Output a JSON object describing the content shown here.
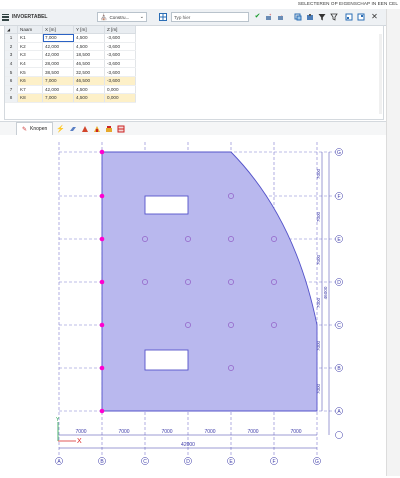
{
  "top_strip": {
    "selection_label": "SELECTEREN OP EIGENSCHAP IN EEN CEL"
  },
  "toolbar": {
    "title": "INVOERTABEL",
    "construction_dropdown": "Constru...",
    "filter_placeholder": "Typ hier"
  },
  "table": {
    "columns": [
      "Naam",
      "X [m]",
      "Y [m]",
      "Z [m]"
    ],
    "rows": [
      {
        "num": "1",
        "name": "K1",
        "x": "7,000",
        "y": "4,500",
        "z": "-3,600",
        "highlight": false
      },
      {
        "num": "2",
        "name": "K2",
        "x": "42,000",
        "y": "4,500",
        "z": "-3,600",
        "highlight": false
      },
      {
        "num": "3",
        "name": "K3",
        "x": "42,000",
        "y": "18,500",
        "z": "-3,600",
        "highlight": false
      },
      {
        "num": "4",
        "name": "K4",
        "x": "28,000",
        "y": "46,500",
        "z": "-3,600",
        "highlight": false
      },
      {
        "num": "5",
        "name": "K5",
        "x": "38,500",
        "y": "32,500",
        "z": "-3,600",
        "highlight": false
      },
      {
        "num": "6",
        "name": "K6",
        "x": "7,000",
        "y": "46,500",
        "z": "-3,600",
        "highlight": true
      },
      {
        "num": "7",
        "name": "K7",
        "x": "42,000",
        "y": "4,500",
        "z": "0,000",
        "highlight": false
      },
      {
        "num": "8",
        "name": "K8",
        "x": "7,000",
        "y": "4,500",
        "z": "0,000",
        "highlight": true
      }
    ]
  },
  "bottom_bar": {
    "tab_label": "Knopen"
  },
  "drawing": {
    "fill_color": "#b9b8ee",
    "outline_color": "#5453c9",
    "node_color": "#ff00d0",
    "col_labels": [
      "A",
      "B",
      "C",
      "D",
      "E",
      "F",
      "G"
    ],
    "row_labels": [
      "G",
      "F",
      "E",
      "D",
      "C",
      "B",
      "A"
    ],
    "bottom_dims": [
      "7000",
      "7000",
      "7000",
      "7000",
      "7000",
      "7000"
    ],
    "total_bottom": "42000",
    "right_dims": [
      "7000",
      "7000",
      "7000",
      "7000",
      "7000",
      "7000"
    ],
    "total_right": "46000",
    "axis_x": "X",
    "axis_y": "Y"
  }
}
